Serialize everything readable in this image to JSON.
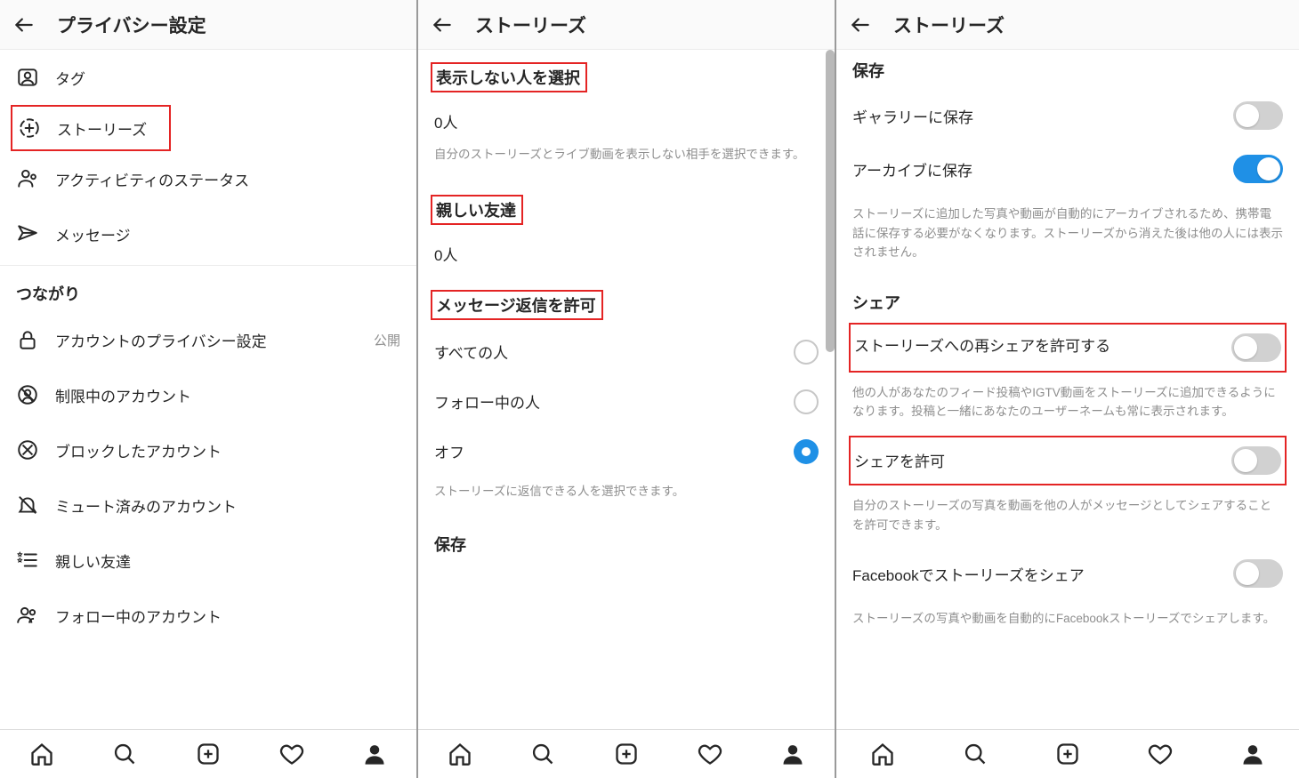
{
  "screen1": {
    "title": "プライバシー設定",
    "items": {
      "tags": "タグ",
      "stories": "ストーリーズ",
      "activity": "アクティビティのステータス",
      "messages": "メッセージ"
    },
    "section_connections": "つながり",
    "conn_items": {
      "account_privacy": {
        "label": "アカウントのプライバシー設定",
        "value": "公開"
      },
      "restricted": "制限中のアカウント",
      "blocked": "ブロックしたアカウント",
      "muted": "ミュート済みのアカウント",
      "close_friends": "親しい友達",
      "following": "フォロー中のアカウント"
    }
  },
  "screen2": {
    "title": "ストーリーズ",
    "section_hide": "表示しない人を選択",
    "hide_count": "0人",
    "hide_desc": "自分のストーリーズとライブ動画を表示しない相手を選択できます。",
    "section_close_friends": "親しい友達",
    "cf_count": "0人",
    "section_reply": "メッセージ返信を許可",
    "reply_opts": {
      "everyone": "すべての人",
      "following": "フォロー中の人",
      "off": "オフ"
    },
    "reply_desc": "ストーリーズに返信できる人を選択できます。",
    "section_save": "保存"
  },
  "screen3": {
    "title": "ストーリーズ",
    "section_save": "保存",
    "save_gallery": "ギャラリーに保存",
    "save_archive": "アーカイブに保存",
    "archive_desc": "ストーリーズに追加した写真や動画が自動的にアーカイブされるため、携帯電話に保存する必要がなくなります。ストーリーズから消えた後は他の人には表示されません。",
    "section_share": "シェア",
    "share_reshare": "ストーリーズへの再シェアを許可する",
    "reshare_desc": "他の人があなたのフィード投稿やIGTV動画をストーリーズに追加できるようになります。投稿と一緒にあなたのユーザーネームも常に表示されます。",
    "share_allow": "シェアを許可",
    "share_allow_desc": "自分のストーリーズの写真を動画を他の人がメッセージとしてシェアすることを許可できます。",
    "share_fb": "Facebookでストーリーズをシェア",
    "share_fb_desc": "ストーリーズの写真や動画を自動的にFacebookストーリーズでシェアします。"
  }
}
